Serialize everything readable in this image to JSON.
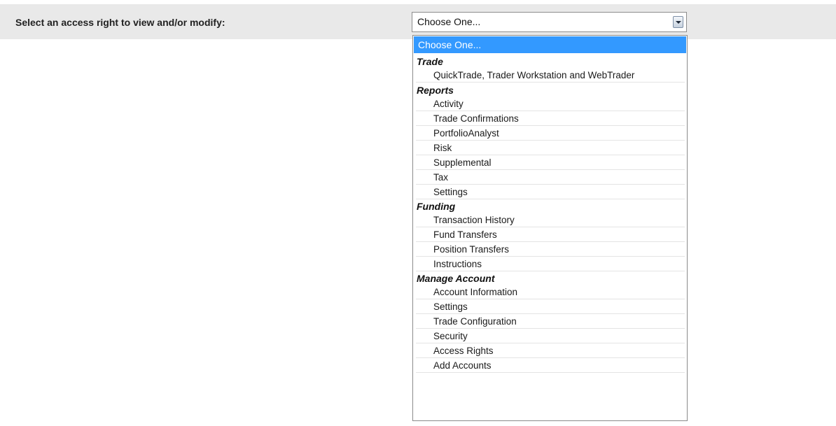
{
  "prompt": {
    "label": "Select an access right to view and/or modify:"
  },
  "select": {
    "value": "Choose One..."
  },
  "dropdown": {
    "selected_option": "Choose One...",
    "groups": [
      {
        "label": "Trade",
        "items": [
          "QuickTrade, Trader Workstation and WebTrader"
        ]
      },
      {
        "label": "Reports",
        "items": [
          "Activity",
          "Trade Confirmations",
          "PortfolioAnalyst",
          "Risk",
          "Supplemental",
          "Tax",
          "Settings"
        ]
      },
      {
        "label": "Funding",
        "items": [
          "Transaction History",
          "Fund Transfers",
          "Position Transfers",
          "Instructions"
        ]
      },
      {
        "label": "Manage Account",
        "items": [
          "Account Information",
          "Settings",
          "Trade Configuration",
          "Security",
          "Access Rights",
          "Add Accounts"
        ]
      }
    ]
  },
  "icons": {
    "select_arrow": "chevron-down-icon"
  },
  "colors": {
    "highlight": "#3399ff",
    "header_bg": "#e9e9e9"
  }
}
